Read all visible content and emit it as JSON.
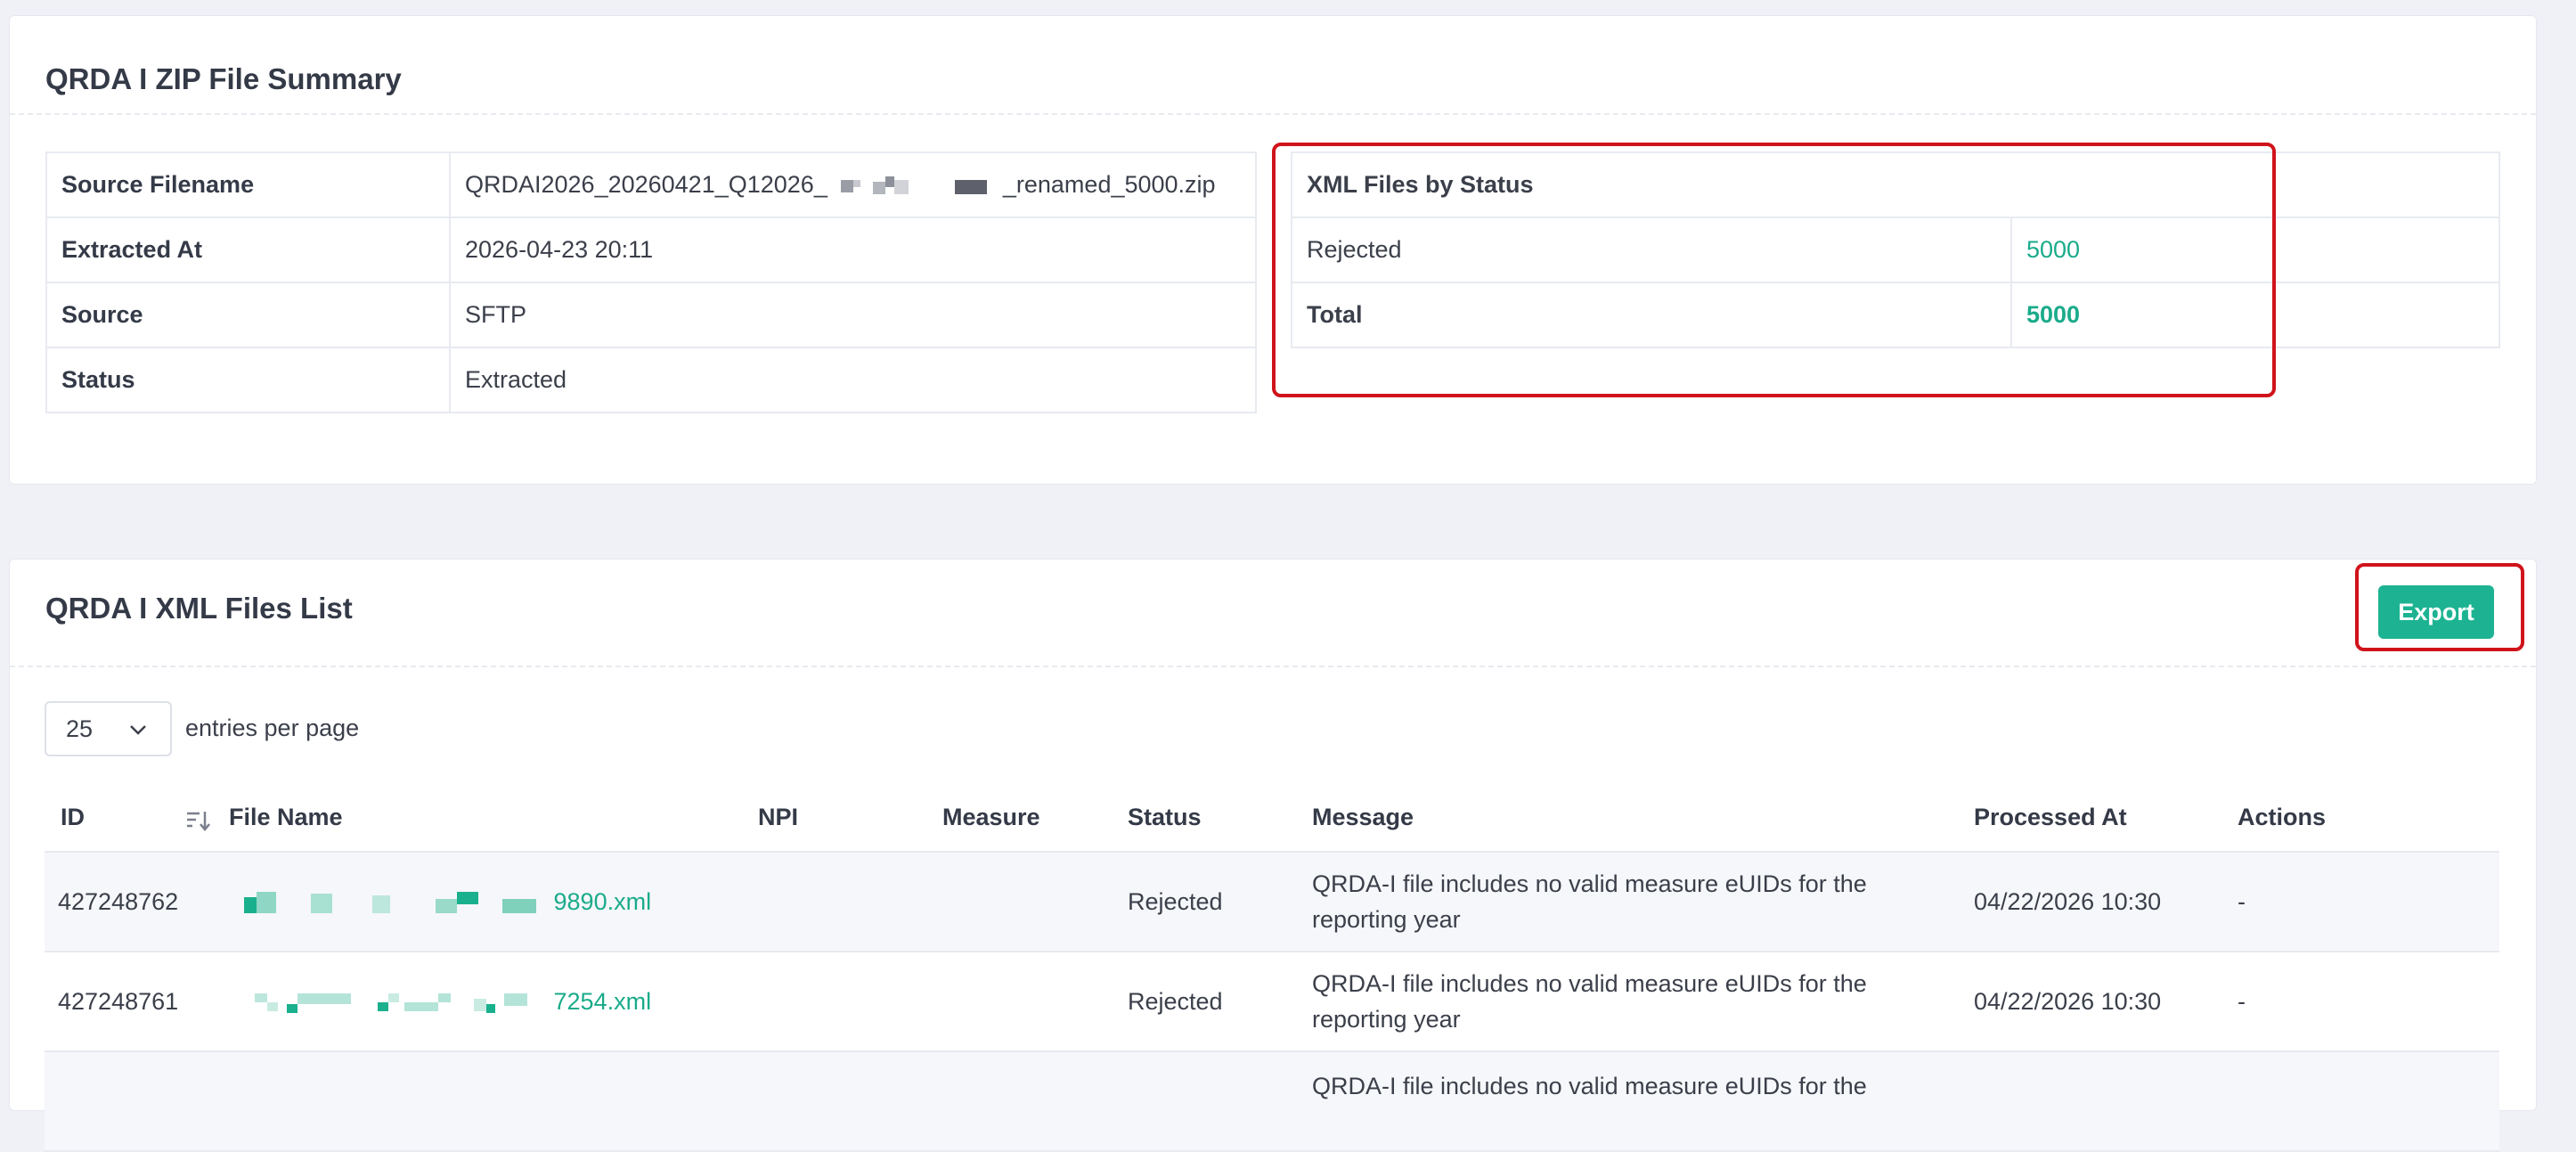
{
  "summary": {
    "title": "QRDA I ZIP File Summary",
    "rows": [
      {
        "label": "Source Filename",
        "value_prefix": "QRDAI2026_20260421_Q12026_",
        "value_suffix": "_renamed_5000.zip"
      },
      {
        "label": "Extracted At",
        "value": "2026-04-23 20:11"
      },
      {
        "label": "Source",
        "value": "SFTP"
      },
      {
        "label": "Status",
        "value": "Extracted"
      }
    ],
    "status_box": {
      "title": "XML Files by Status",
      "rows": [
        {
          "label": "Rejected",
          "value": "5000"
        },
        {
          "label": "Total",
          "value": "5000"
        }
      ]
    }
  },
  "list": {
    "title": "QRDA I XML Files List",
    "export_label": "Export",
    "page_size": "25",
    "entries_label": "entries per page",
    "columns": [
      "ID",
      "File Name",
      "NPI",
      "Measure",
      "Status",
      "Message",
      "Processed At",
      "Actions"
    ],
    "rows": [
      {
        "id": "427248762",
        "file_suffix": "9890.xml",
        "npi": "",
        "measure": "",
        "status": "Rejected",
        "message": "QRDA-I file includes no valid measure eUIDs for the reporting year",
        "processed_at": "04/22/2026 10:30",
        "actions": "-"
      },
      {
        "id": "427248761",
        "file_suffix": "7254.xml",
        "npi": "",
        "measure": "",
        "status": "Rejected",
        "message": "QRDA-I file includes no valid measure eUIDs for the reporting year",
        "processed_at": "04/22/2026 10:30",
        "actions": "-"
      },
      {
        "id": "",
        "file_suffix": "",
        "npi": "",
        "measure": "",
        "status": "",
        "message": "QRDA-I file includes no valid measure eUIDs for the",
        "processed_at": "",
        "actions": ""
      }
    ]
  },
  "colors": {
    "accent": "#1db392",
    "link": "#1aab8a",
    "highlight": "#d0131b"
  },
  "icons": {
    "sort": "sort-desc-icon",
    "dropdown": "chevron-down-icon"
  }
}
